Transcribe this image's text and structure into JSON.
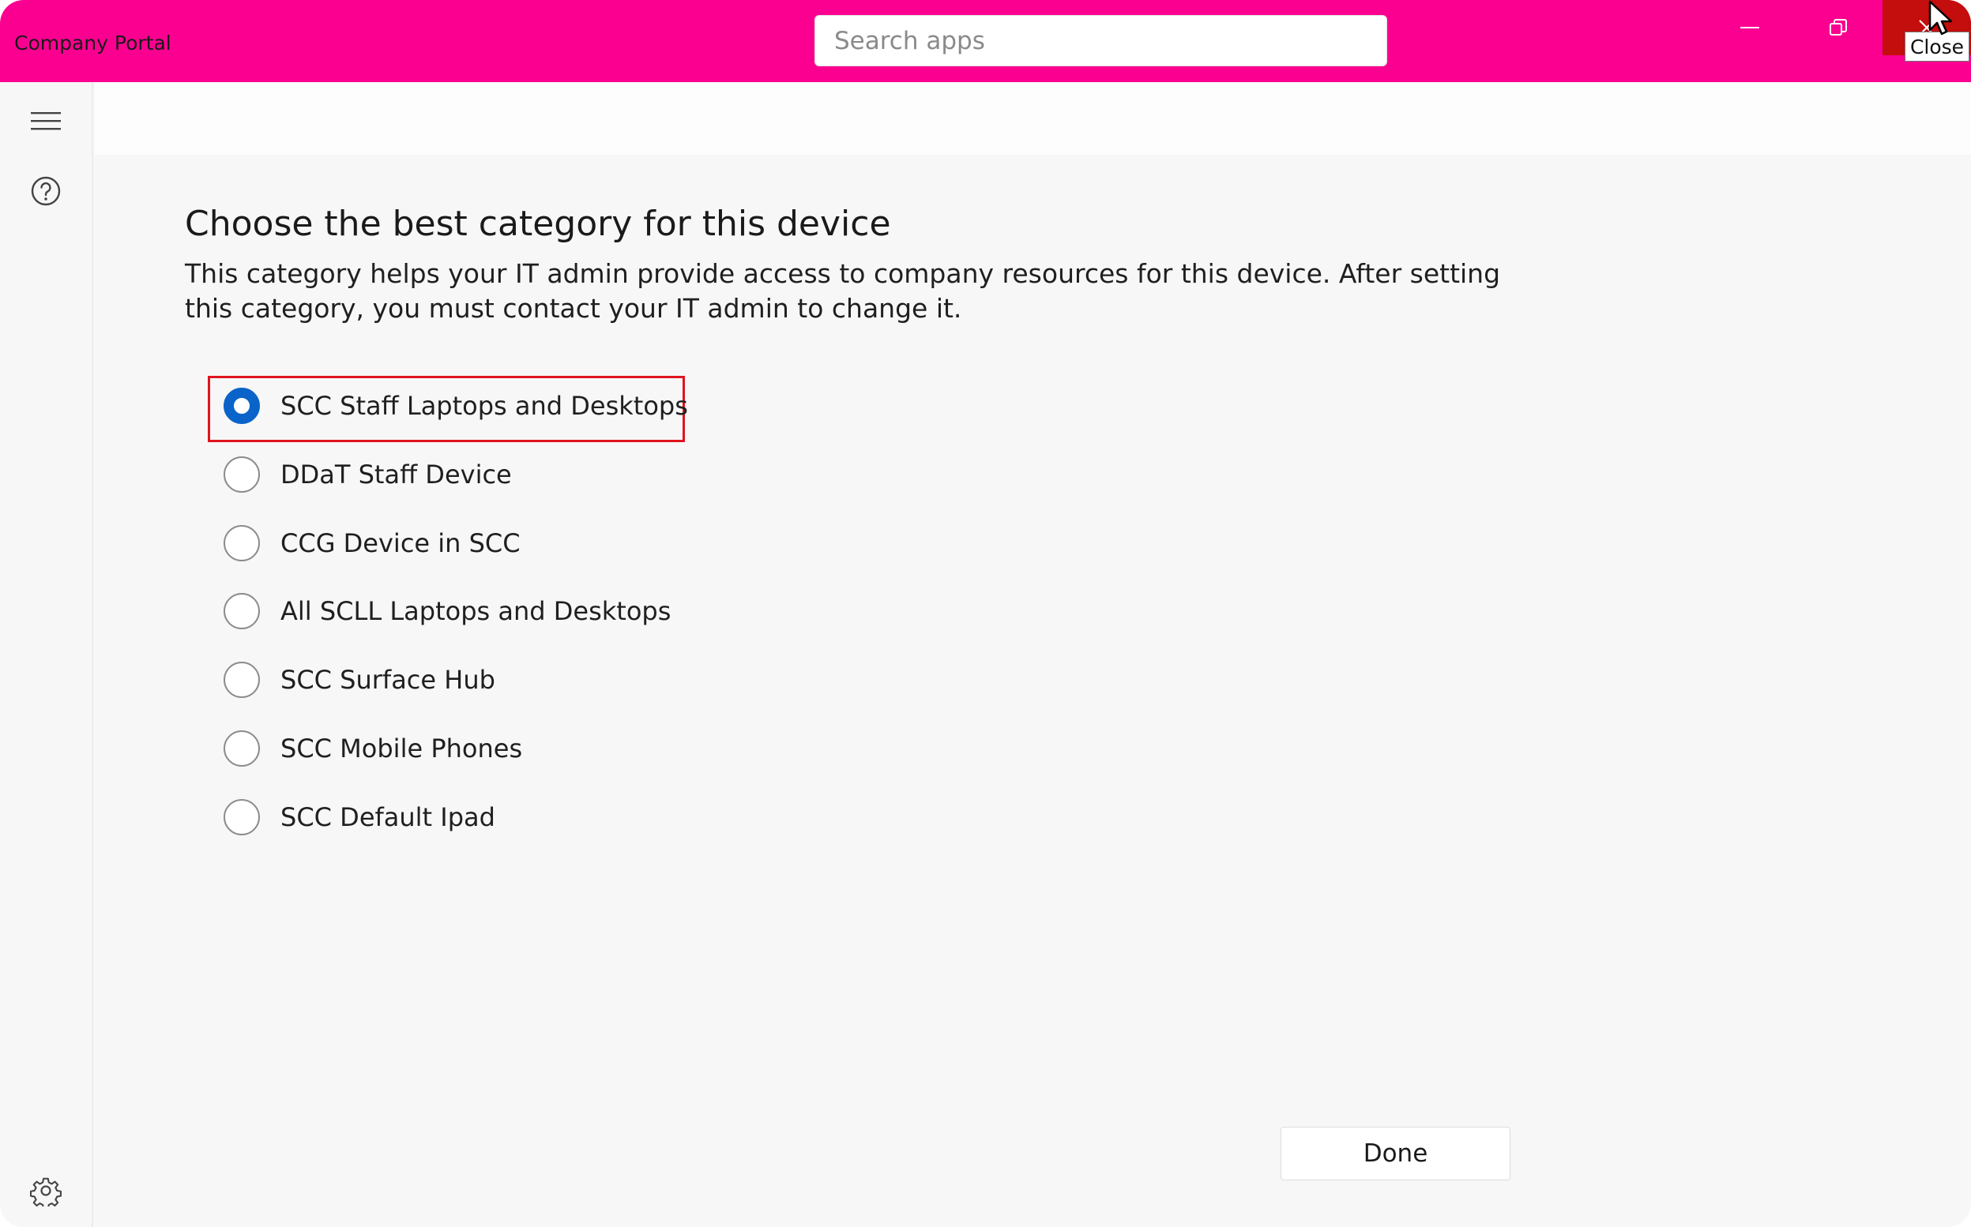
{
  "app": {
    "title": "Company Portal"
  },
  "search": {
    "placeholder": "Search apps"
  },
  "window_controls": {
    "close_tooltip": "Close"
  },
  "page": {
    "heading": "Choose the best category for this device",
    "description": "This category helps your IT admin provide access to company resources for this device. After setting this category, you must contact your IT admin to change it."
  },
  "categories": [
    {
      "label": "SCC Staff Laptops and Desktops",
      "selected": true
    },
    {
      "label": "DDaT Staff Device",
      "selected": false
    },
    {
      "label": "CCG Device in SCC",
      "selected": false
    },
    {
      "label": "All SCLL Laptops and Desktops",
      "selected": false
    },
    {
      "label": "SCC Surface Hub",
      "selected": false
    },
    {
      "label": "SCC Mobile Phones",
      "selected": false
    },
    {
      "label": "SCC Default Ipad",
      "selected": false
    }
  ],
  "actions": {
    "done_label": "Done"
  },
  "colors": {
    "titlebar": "#fb0090",
    "accent": "#0a63c9",
    "highlight": "#e0141e",
    "close": "#c40d0d"
  },
  "icons": {
    "menu": "hamburger-icon",
    "help": "help-icon",
    "settings": "gear-icon"
  }
}
